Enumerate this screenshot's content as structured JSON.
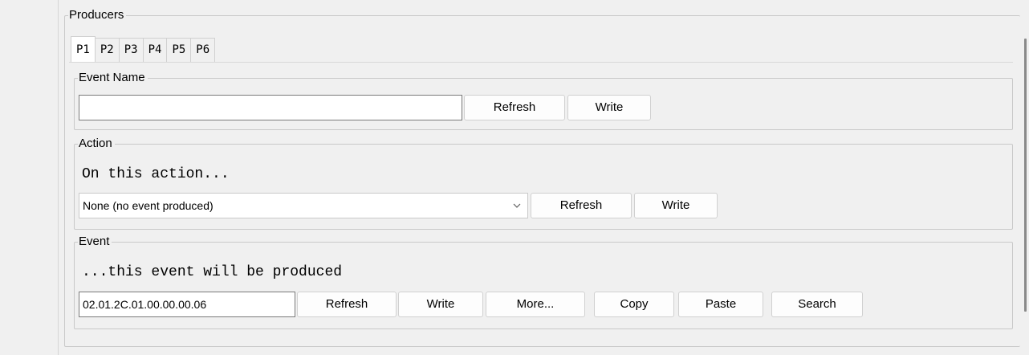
{
  "producers": {
    "legend": "Producers",
    "tabs": [
      "P1",
      "P2",
      "P3",
      "P4",
      "P5",
      "P6"
    ],
    "active_tab": "P1"
  },
  "event_name": {
    "legend": "Event Name",
    "value": "",
    "refresh_label": "Refresh",
    "write_label": "Write"
  },
  "action": {
    "legend": "Action",
    "caption": "On this action...",
    "selected": "None (no event produced)",
    "refresh_label": "Refresh",
    "write_label": "Write"
  },
  "event": {
    "legend": "Event",
    "caption": "...this event will be produced",
    "value": "02.01.2C.01.00.00.00.06",
    "refresh_label": "Refresh",
    "write_label": "Write",
    "more_label": "More...",
    "copy_label": "Copy",
    "paste_label": "Paste",
    "search_label": "Search"
  }
}
